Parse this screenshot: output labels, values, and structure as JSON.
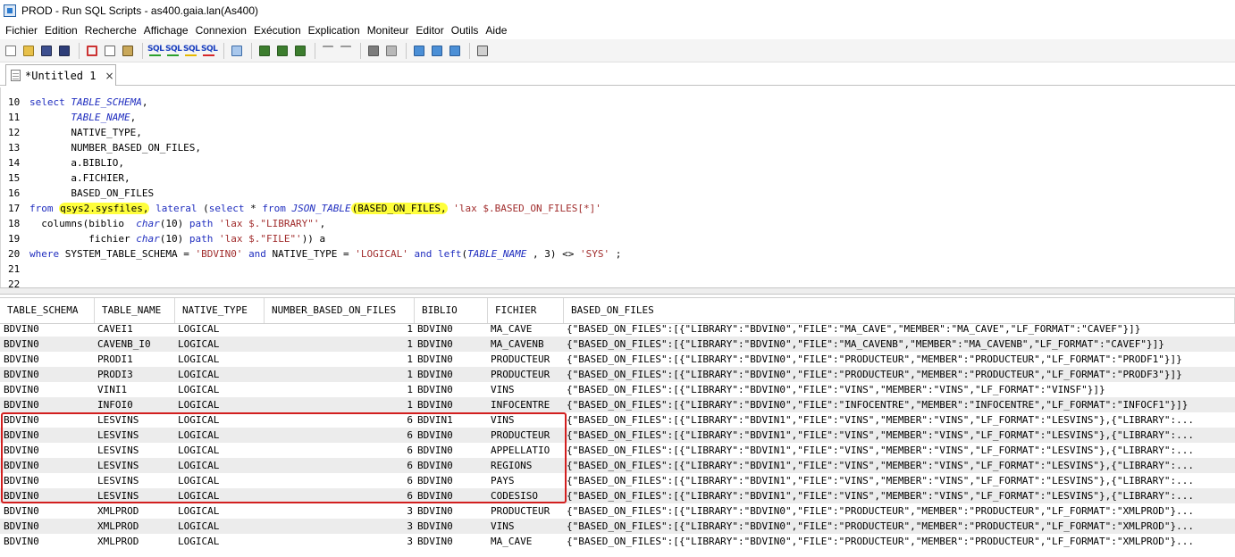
{
  "window": {
    "title": "PROD - Run SQL Scripts - as400.gaia.lan(As400)"
  },
  "menu": [
    "Fichier",
    "Edition",
    "Recherche",
    "Affichage",
    "Connexion",
    "Exécution",
    "Explication",
    "Moniteur",
    "Editor",
    "Outils",
    "Aide"
  ],
  "toolbar": {
    "icons": [
      "new-document-icon",
      "open-folder-icon",
      "save-icon",
      "save-all-icon",
      "cut-icon",
      "copy-icon",
      "paste-icon",
      "run-sql-all-icon",
      "run-sql-selected-icon",
      "run-sql-from-cursor-icon",
      "run-sql-single-icon",
      "run-icon",
      "explain-icon",
      "visual-explain-icon",
      "explain-run-icon",
      "undo-icon",
      "redo-icon",
      "stop-icon",
      "cancel-icon",
      "monitor-start-icon",
      "monitor-stop-icon",
      "monitor-view-icon",
      "print-icon"
    ],
    "sql_text": "SQL"
  },
  "tab": {
    "label": "*Untitled 1",
    "close": "×"
  },
  "editor": {
    "lines": [
      {
        "n": "10",
        "tokens": [
          [
            "kw",
            "select "
          ],
          [
            "fn",
            "TABLE_SCHEMA"
          ],
          [
            "plain",
            ","
          ]
        ]
      },
      {
        "n": "11",
        "tokens": [
          [
            "plain",
            "       "
          ],
          [
            "fn",
            "TABLE_NAME"
          ],
          [
            "plain",
            ","
          ]
        ]
      },
      {
        "n": "12",
        "tokens": [
          [
            "plain",
            "       NATIVE_TYPE,"
          ]
        ]
      },
      {
        "n": "13",
        "tokens": [
          [
            "plain",
            "       NUMBER_BASED_ON_FILES,"
          ]
        ]
      },
      {
        "n": "14",
        "tokens": [
          [
            "plain",
            "       a.BIBLIO,"
          ]
        ]
      },
      {
        "n": "15",
        "tokens": [
          [
            "plain",
            "       a.FICHIER,"
          ]
        ]
      },
      {
        "n": "16",
        "tokens": [
          [
            "plain",
            "       BASED_ON_FILES"
          ]
        ]
      },
      {
        "n": "17",
        "tokens": [
          [
            "kw",
            "from "
          ],
          [
            "hl",
            "qsys2.sysfiles,"
          ],
          [
            "plain",
            " "
          ],
          [
            "kw",
            "lateral"
          ],
          [
            "plain",
            " ("
          ],
          [
            "kw",
            "select"
          ],
          [
            "plain",
            " * "
          ],
          [
            "kw",
            "from "
          ],
          [
            "fn",
            "JSON_TABLE"
          ],
          [
            "hl",
            "(BASED_ON_FILES,"
          ],
          [
            "plain",
            " "
          ],
          [
            "str",
            "'lax $.BASED_ON_FILES[*]'"
          ]
        ]
      },
      {
        "n": "18",
        "tokens": [
          [
            "plain",
            "  columns(biblio  "
          ],
          [
            "fn",
            "char"
          ],
          [
            "plain",
            "(10) "
          ],
          [
            "kw",
            "path"
          ],
          [
            "plain",
            " "
          ],
          [
            "str",
            "'lax $.\"LIBRARY\"'"
          ],
          [
            "plain",
            ","
          ]
        ]
      },
      {
        "n": "19",
        "tokens": [
          [
            "plain",
            "          fichier "
          ],
          [
            "fn",
            "char"
          ],
          [
            "plain",
            "(10) "
          ],
          [
            "kw",
            "path"
          ],
          [
            "plain",
            " "
          ],
          [
            "str",
            "'lax $.\"FILE\"'"
          ],
          [
            "plain",
            ")) a"
          ]
        ]
      },
      {
        "n": "20",
        "tokens": [
          [
            "kw",
            "where"
          ],
          [
            "plain",
            " SYSTEM_TABLE_SCHEMA = "
          ],
          [
            "str",
            "'BDVIN0'"
          ],
          [
            "plain",
            " "
          ],
          [
            "kw",
            "and"
          ],
          [
            "plain",
            " NATIVE_TYPE = "
          ],
          [
            "str",
            "'LOGICAL'"
          ],
          [
            "plain",
            " "
          ],
          [
            "kw",
            "and"
          ],
          [
            "plain",
            " "
          ],
          [
            "kw",
            "left"
          ],
          [
            "plain",
            "("
          ],
          [
            "fn",
            "TABLE_NAME"
          ],
          [
            "plain",
            " , 3) <> "
          ],
          [
            "str",
            "'SYS'"
          ],
          [
            "plain",
            " ;"
          ]
        ]
      },
      {
        "n": "21",
        "tokens": []
      },
      {
        "n": "22",
        "tokens": []
      }
    ]
  },
  "results": {
    "columns": [
      "TABLE_SCHEMA",
      "TABLE_NAME",
      "NATIVE_TYPE",
      "NUMBER_BASED_ON_FILES",
      "BIBLIO",
      "FICHIER",
      "BASED_ON_FILES"
    ],
    "rows": [
      [
        "BDVIN0",
        "CAVEI1",
        "LOGICAL",
        "1",
        "BDVIN0",
        "MA_CAVE",
        "{\"BASED_ON_FILES\":[{\"LIBRARY\":\"BDVIN0\",\"FILE\":\"MA_CAVE\",\"MEMBER\":\"MA_CAVE\",\"LF_FORMAT\":\"CAVEF\"}]}"
      ],
      [
        "BDVIN0",
        "CAVENB_I0",
        "LOGICAL",
        "1",
        "BDVIN0",
        "MA_CAVENB",
        "{\"BASED_ON_FILES\":[{\"LIBRARY\":\"BDVIN0\",\"FILE\":\"MA_CAVENB\",\"MEMBER\":\"MA_CAVENB\",\"LF_FORMAT\":\"CAVEF\"}]}"
      ],
      [
        "BDVIN0",
        "PRODI1",
        "LOGICAL",
        "1",
        "BDVIN0",
        "PRODUCTEUR",
        "{\"BASED_ON_FILES\":[{\"LIBRARY\":\"BDVIN0\",\"FILE\":\"PRODUCTEUR\",\"MEMBER\":\"PRODUCTEUR\",\"LF_FORMAT\":\"PRODF1\"}]}"
      ],
      [
        "BDVIN0",
        "PRODI3",
        "LOGICAL",
        "1",
        "BDVIN0",
        "PRODUCTEUR",
        "{\"BASED_ON_FILES\":[{\"LIBRARY\":\"BDVIN0\",\"FILE\":\"PRODUCTEUR\",\"MEMBER\":\"PRODUCTEUR\",\"LF_FORMAT\":\"PRODF3\"}]}"
      ],
      [
        "BDVIN0",
        "VINI1",
        "LOGICAL",
        "1",
        "BDVIN0",
        "VINS",
        "{\"BASED_ON_FILES\":[{\"LIBRARY\":\"BDVIN0\",\"FILE\":\"VINS\",\"MEMBER\":\"VINS\",\"LF_FORMAT\":\"VINSF\"}]}"
      ],
      [
        "BDVIN0",
        "INFOI0",
        "LOGICAL",
        "1",
        "BDVIN0",
        "INFOCENTRE",
        "{\"BASED_ON_FILES\":[{\"LIBRARY\":\"BDVIN0\",\"FILE\":\"INFOCENTRE\",\"MEMBER\":\"INFOCENTRE\",\"LF_FORMAT\":\"INFOCF1\"}]}"
      ],
      [
        "BDVIN0",
        "LESVINS",
        "LOGICAL",
        "6",
        "BDVIN1",
        "VINS",
        "{\"BASED_ON_FILES\":[{\"LIBRARY\":\"BDVIN1\",\"FILE\":\"VINS\",\"MEMBER\":\"VINS\",\"LF_FORMAT\":\"LESVINS\"},{\"LIBRARY\":..."
      ],
      [
        "BDVIN0",
        "LESVINS",
        "LOGICAL",
        "6",
        "BDVIN0",
        "PRODUCTEUR",
        "{\"BASED_ON_FILES\":[{\"LIBRARY\":\"BDVIN1\",\"FILE\":\"VINS\",\"MEMBER\":\"VINS\",\"LF_FORMAT\":\"LESVINS\"},{\"LIBRARY\":..."
      ],
      [
        "BDVIN0",
        "LESVINS",
        "LOGICAL",
        "6",
        "BDVIN0",
        "APPELLATIO",
        "{\"BASED_ON_FILES\":[{\"LIBRARY\":\"BDVIN1\",\"FILE\":\"VINS\",\"MEMBER\":\"VINS\",\"LF_FORMAT\":\"LESVINS\"},{\"LIBRARY\":..."
      ],
      [
        "BDVIN0",
        "LESVINS",
        "LOGICAL",
        "6",
        "BDVIN0",
        "REGIONS",
        "{\"BASED_ON_FILES\":[{\"LIBRARY\":\"BDVIN1\",\"FILE\":\"VINS\",\"MEMBER\":\"VINS\",\"LF_FORMAT\":\"LESVINS\"},{\"LIBRARY\":..."
      ],
      [
        "BDVIN0",
        "LESVINS",
        "LOGICAL",
        "6",
        "BDVIN0",
        "PAYS",
        "{\"BASED_ON_FILES\":[{\"LIBRARY\":\"BDVIN1\",\"FILE\":\"VINS\",\"MEMBER\":\"VINS\",\"LF_FORMAT\":\"LESVINS\"},{\"LIBRARY\":..."
      ],
      [
        "BDVIN0",
        "LESVINS",
        "LOGICAL",
        "6",
        "BDVIN0",
        "CODESISO",
        "{\"BASED_ON_FILES\":[{\"LIBRARY\":\"BDVIN1\",\"FILE\":\"VINS\",\"MEMBER\":\"VINS\",\"LF_FORMAT\":\"LESVINS\"},{\"LIBRARY\":..."
      ],
      [
        "BDVIN0",
        "XMLPROD",
        "LOGICAL",
        "3",
        "BDVIN0",
        "PRODUCTEUR",
        "{\"BASED_ON_FILES\":[{\"LIBRARY\":\"BDVIN0\",\"FILE\":\"PRODUCTEUR\",\"MEMBER\":\"PRODUCTEUR\",\"LF_FORMAT\":\"XMLPROD\"}..."
      ],
      [
        "BDVIN0",
        "XMLPROD",
        "LOGICAL",
        "3",
        "BDVIN0",
        "VINS",
        "{\"BASED_ON_FILES\":[{\"LIBRARY\":\"BDVIN0\",\"FILE\":\"PRODUCTEUR\",\"MEMBER\":\"PRODUCTEUR\",\"LF_FORMAT\":\"XMLPROD\"}..."
      ],
      [
        "BDVIN0",
        "XMLPROD",
        "LOGICAL",
        "3",
        "BDVIN0",
        "MA_CAVE",
        "{\"BASED_ON_FILES\":[{\"LIBRARY\":\"BDVIN0\",\"FILE\":\"PRODUCTEUR\",\"MEMBER\":\"PRODUCTEUR\",\"LF_FORMAT\":\"XMLPROD\"}..."
      ]
    ],
    "highlighted_rows": [
      6,
      7,
      8,
      9,
      10,
      11
    ]
  },
  "colors": {
    "keyword": "#1f2dbf",
    "string": "#a12d2d",
    "highlight": "#ffff3c",
    "selection_box": "#d21f1f",
    "row_alt": "#ececec"
  }
}
